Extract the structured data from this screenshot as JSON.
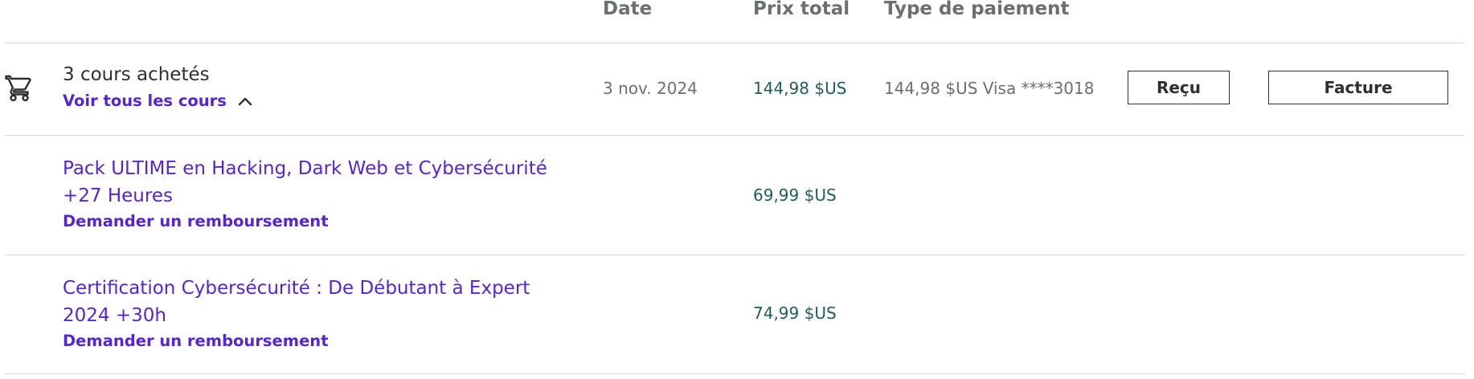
{
  "headers": {
    "date": "Date",
    "total": "Prix total",
    "payment": "Type de paiement"
  },
  "order": {
    "summary": "3 cours achetés",
    "view_all": "Voir tous les cours",
    "date": "3 nov. 2024",
    "total": "144,98 $US",
    "payment": "144,98 $US Visa ****3018",
    "receipt_label": "Reçu",
    "invoice_label": "Facture"
  },
  "courses": [
    {
      "title_line1": "Pack ULTIME en Hacking, Dark Web et Cybersécurité",
      "title_line2": "+27 Heures",
      "refund": "Demander un remboursement",
      "price": "69,99 $US"
    },
    {
      "title_line1": "Certification Cybersécurité : De Débutant à Expert",
      "title_line2": "2024 +30h",
      "refund": "Demander un remboursement",
      "price": "74,99 $US"
    }
  ],
  "icons": {
    "cart": "shopping-cart-icon",
    "expand": "chevron-up-icon"
  },
  "colors": {
    "link": "#5624d0",
    "price": "#1e6055",
    "muted": "#6a6f73",
    "text": "#2d2f31",
    "divider": "#d1d7dc"
  }
}
